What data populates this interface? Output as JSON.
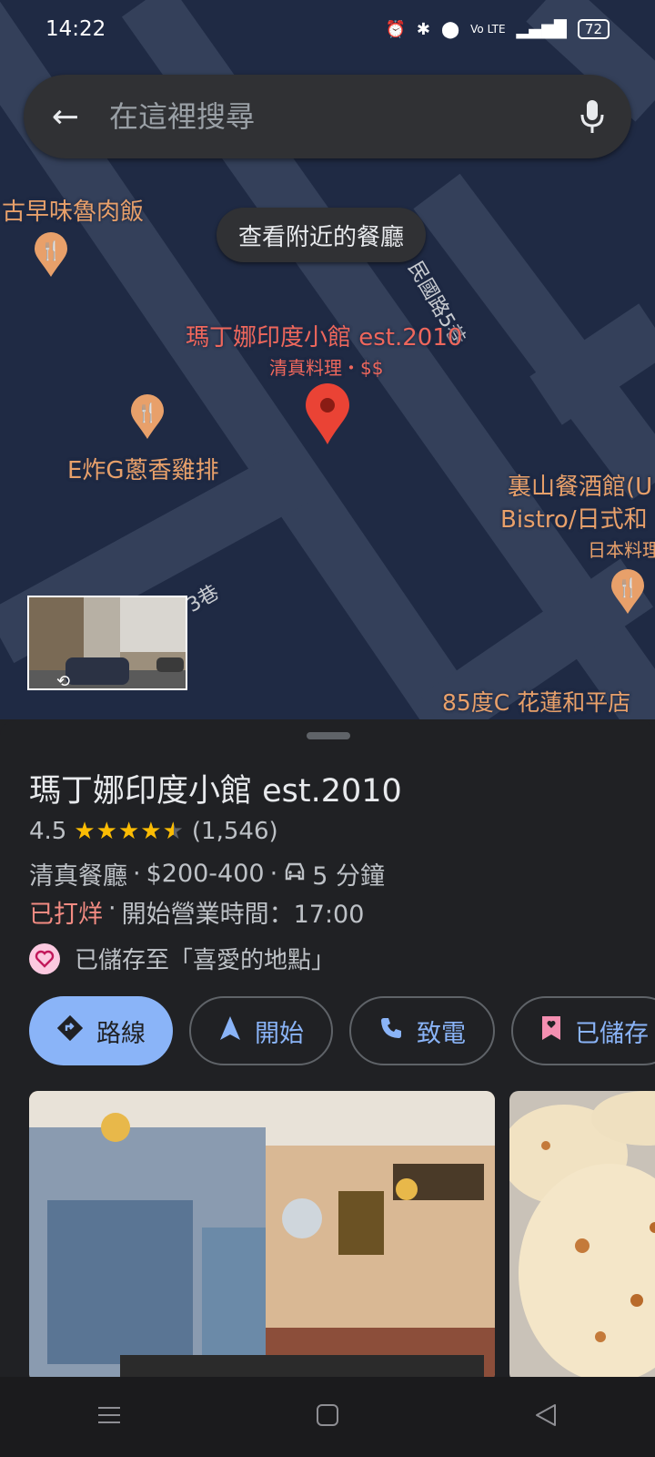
{
  "status_bar": {
    "time": "14:22",
    "battery": "72"
  },
  "search": {
    "placeholder": "在這裡搜尋"
  },
  "map": {
    "chip_label": "查看附近的餐廳",
    "labels": {
      "restaurant_topleft": "古早味魯肉飯",
      "road_minguo": "民國路5巷",
      "selected_name": "瑪丁娜印度小館 est.2010",
      "selected_sub": "清真料理・$$",
      "chicken": "E炸G蔥香雞排",
      "bistro_line1": "裏山餐酒館(U",
      "bistro_line2": "Bistro/日式和",
      "bistro_line3": "日本料理",
      "lane3": "3巷",
      "cafe": "85度C 花蓮和平店"
    }
  },
  "place": {
    "name": "瑪丁娜印度小館 est.2010",
    "rating": "4.5",
    "stars": "★★★★",
    "reviews": "(1,546)",
    "category": "清真餐廳",
    "price": "$200-400",
    "drive_time": "5 分鐘",
    "status": "已打烊",
    "hours": "開始營業時間：17:00",
    "saved_text": "已儲存至「喜愛的地點」"
  },
  "actions": {
    "directions": "路線",
    "start": "開始",
    "call": "致電",
    "saved": "已儲存"
  },
  "colors": {
    "accent_blue": "#8ab4f8",
    "closed_red": "#f28b82",
    "map_orange": "#e8a06a",
    "pin_red": "#ea4335",
    "star_yellow": "#fbbc04"
  }
}
